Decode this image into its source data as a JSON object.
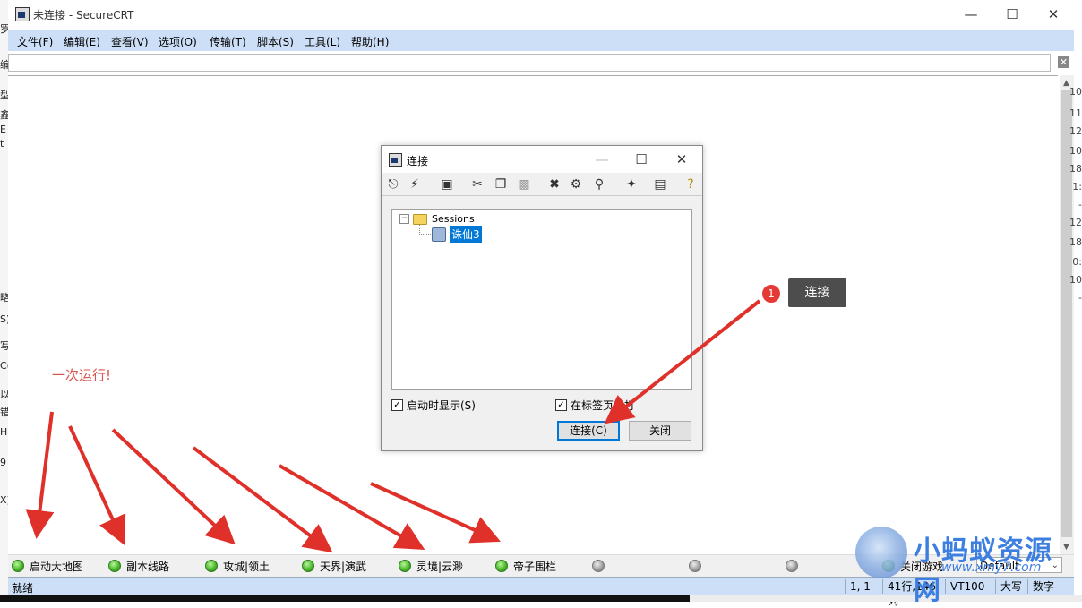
{
  "app": {
    "window_title": "未连接 - SecureCRT",
    "menus": [
      "文件(F)",
      "编辑(E)",
      "查看(V)",
      "选项(O)",
      "传输(T)",
      "脚本(S)",
      "工具(L)",
      "帮助(H)"
    ],
    "address_value": ""
  },
  "left_strip": [
    "罗",
    "编",
    "型",
    "鑫",
    "E",
    "t",
    "略",
    "S)",
    "写",
    "C(",
    "以",
    "错",
    "H",
    "9",
    "X)"
  ],
  "right_strip": [
    "10",
    "11",
    "12",
    "10",
    "18",
    "1:",
    "-",
    "12",
    "18",
    "0:",
    "10",
    "-"
  ],
  "button_bar": {
    "buttons": [
      {
        "label": "启动大地图",
        "led": "green"
      },
      {
        "label": "副本线路",
        "led": "green"
      },
      {
        "label": "攻城|领土",
        "led": "green"
      },
      {
        "label": "天界|演武",
        "led": "green"
      },
      {
        "label": "灵境|云渺",
        "led": "green"
      },
      {
        "label": "帝子围栏",
        "led": "green"
      },
      {
        "label": "",
        "led": "gray"
      },
      {
        "label": "",
        "led": "gray"
      },
      {
        "label": "",
        "led": "gray"
      },
      {
        "label": "关闭游戏",
        "led": "green"
      }
    ],
    "selector_value": "Default"
  },
  "status_bar": {
    "state": "就绪",
    "cursor": "1,   1",
    "size": "41行,146列",
    "terminal": "VT100",
    "caps": "大写",
    "num": "数字"
  },
  "dialog": {
    "title": "连接",
    "toolbar_icons": [
      "connect-icon",
      "quick-connect-icon",
      "new-session-icon",
      "cut-icon",
      "copy-icon",
      "paste-icon",
      "delete-icon",
      "properties-icon",
      "find-icon",
      "new-folder-icon",
      "desktop-icon",
      "help-icon"
    ],
    "tree_root": "Sessions",
    "session_name": "诛仙3",
    "checkbox_show_on_startup": "启动时显示(S)",
    "checkbox_open_in_tab": "在标签页中打",
    "connect_button": "连接(C)",
    "close_button": "关闭"
  },
  "annotations": {
    "callout_number": "1",
    "callout_label": "连接",
    "run_once_text": "一次运行!"
  },
  "watermark": {
    "brand": "小蚂蚁资源网",
    "url": "www.xmy7.com"
  },
  "colors": {
    "menubar": "#ccdff7",
    "selection": "#0078d7",
    "annotation_red": "#d9534f",
    "led_green": "#4bb82a"
  }
}
